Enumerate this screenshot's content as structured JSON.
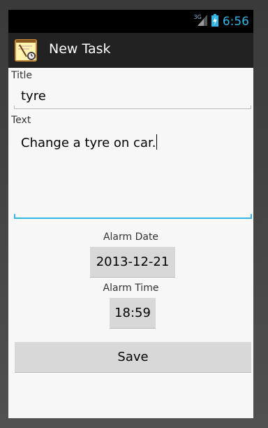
{
  "status_bar": {
    "network_type": "3G",
    "time": "6:56",
    "icons": [
      "signal-icon",
      "battery-charging-icon"
    ]
  },
  "action_bar": {
    "title": "New Task",
    "icon": "notepad-alarm-icon"
  },
  "form": {
    "title_label": "Title",
    "title_value": "tyre",
    "text_label": "Text",
    "text_value": "Change a tyre on car.",
    "alarm_date_label": "Alarm Date",
    "alarm_date_value": "2013-12-21",
    "alarm_time_label": "Alarm Time",
    "alarm_time_value": "18:59",
    "save_label": "Save"
  },
  "colors": {
    "accent": "#33b5e5",
    "action_bar_bg": "#222222",
    "button_bg": "#d8d8d8"
  }
}
